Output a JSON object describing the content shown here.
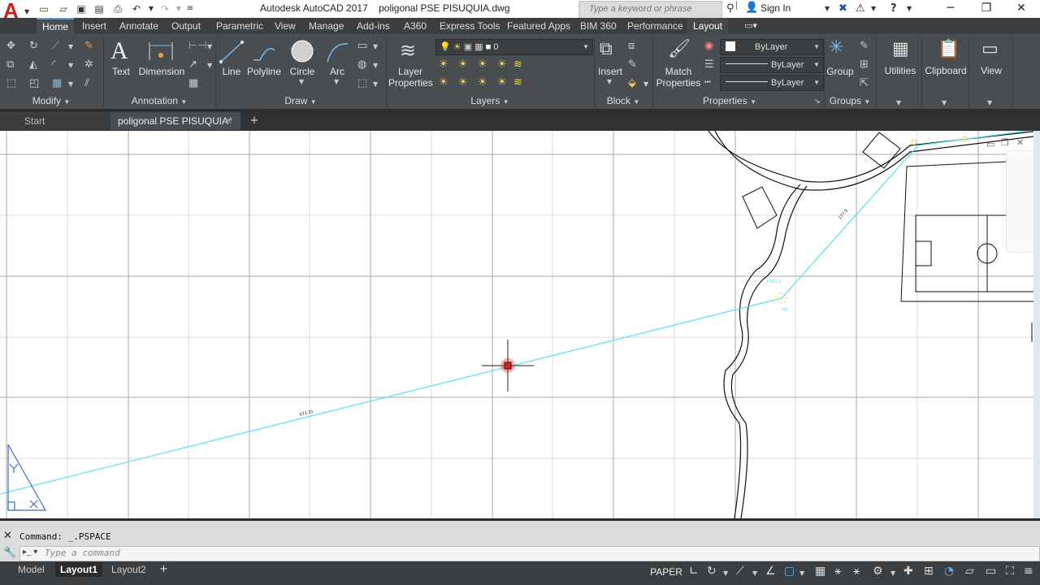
{
  "titlebar": {
    "app_name": "Autodesk AutoCAD 2017",
    "document": "poligonal PSE PISUQUIA.dwg",
    "search_placeholder": "Type a keyword or phrase",
    "sign_in": "Sign In"
  },
  "ribbon_tabs": [
    "Home",
    "Insert",
    "Annotate",
    "Output",
    "Parametric",
    "View",
    "Manage",
    "Add-ins",
    "A360",
    "Express Tools",
    "Featured Apps",
    "BIM 360",
    "Performance",
    "Layout"
  ],
  "panels": {
    "modify": "Modify",
    "annotation": "Annotation",
    "draw": "Draw",
    "layers": "Layers",
    "block": "Block",
    "properties": "Properties",
    "groups": "Groups"
  },
  "buttons": {
    "text": "Text",
    "dimension": "Dimension",
    "line": "Line",
    "polyline": "Polyline",
    "circle": "Circle",
    "arc": "Arc",
    "layer_properties_1": "Layer",
    "layer_properties_2": "Properties",
    "insert": "Insert",
    "match_properties_1": "Match",
    "match_properties_2": "Properties",
    "group": "Group",
    "utilities": "Utilities",
    "clipboard": "Clipboard",
    "view": "View"
  },
  "layer_dropdown": "0",
  "properties": {
    "color": "ByLayer",
    "linetype": "ByLayer",
    "lineweight": "ByLayer"
  },
  "doc_tabs": {
    "start": "Start",
    "current": "poligonal PSE PISUQUIA*"
  },
  "drawing_labels": {
    "segment_label_1": "973.35",
    "segment_label_2": "177.9",
    "point_label_1": "PSE2-2",
    "point_label_2": "P8"
  },
  "command": {
    "history": "Command:  _.PSPACE",
    "placeholder": "Type a command"
  },
  "layout_tabs": [
    "Model",
    "Layout1",
    "Layout2"
  ],
  "status": {
    "paper": "PAPER"
  },
  "colors": {
    "accent": "#5e9bd6",
    "cyan_line": "#4fe3f0",
    "cursor": "#e02020"
  }
}
